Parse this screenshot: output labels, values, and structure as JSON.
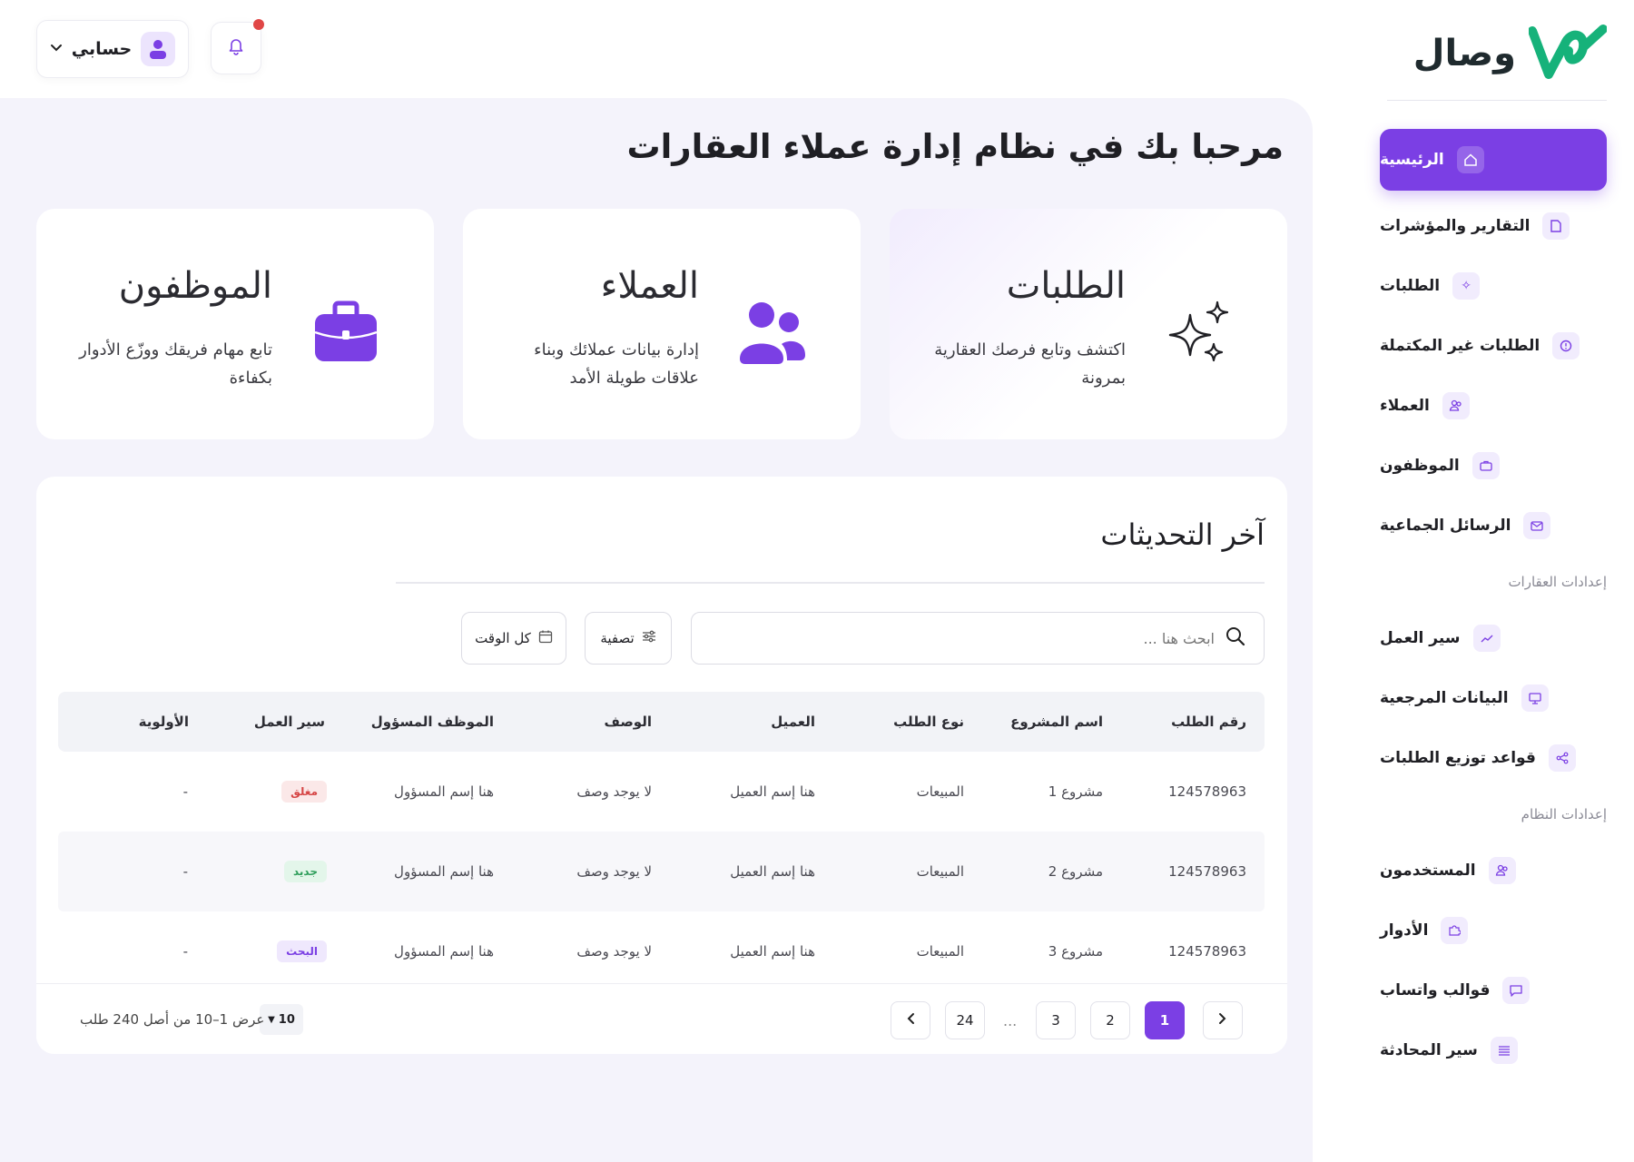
{
  "brand": {
    "name": "وصال"
  },
  "topbar": {
    "account_label": "حسابي"
  },
  "sidebar": {
    "items": [
      {
        "label": "الرئيسية",
        "active": true
      },
      {
        "label": "التقارير والمؤشرات"
      },
      {
        "label": "الطلبات"
      },
      {
        "label": "الطلبات غير المكتملة"
      },
      {
        "label": "العملاء"
      },
      {
        "label": "الموظفون"
      },
      {
        "label": "الرسائل الجماعية"
      }
    ],
    "section_realestate": "إعدادات العقارات",
    "realestate_items": [
      {
        "label": "سير العمل"
      },
      {
        "label": "البيانات المرجعية"
      },
      {
        "label": "قواعد توزيع الطلبات"
      }
    ],
    "section_system": "إعدادات النظام",
    "system_items": [
      {
        "label": "المستخدمون"
      },
      {
        "label": "الأدوار"
      },
      {
        "label": "قوالب واتساب"
      },
      {
        "label": "سير المحادثة"
      }
    ]
  },
  "main": {
    "title": "مرحبا بك في نظام إدارة عملاء العقارات",
    "cards": [
      {
        "title": "الطلبات",
        "desc": "اكتشف وتابع فرصك العقارية بمرونة"
      },
      {
        "title": "العملاء",
        "desc": "إدارة بيانات عملائك وبناء علاقات طويلة الأمد"
      },
      {
        "title": "الموظفون",
        "desc": "تابع مهام فريقك ووزّع الأدوار بكفاءة"
      }
    ]
  },
  "updates": {
    "title": "آخر التحديثات",
    "search_placeholder": "ابحث هنا ...",
    "filter_label": "تصفية",
    "time_label": "كل الوقت",
    "columns": [
      "رقم الطلب",
      "اسم المشروع",
      "نوع الطلب",
      "العميل",
      "الوصف",
      "الموظف المسؤول",
      "سير العمل",
      "الأولوية"
    ],
    "rows": [
      {
        "id": "124578963",
        "project": "مشروع 1",
        "type": "المبيعات",
        "client": "هنا إسم العميل",
        "desc": "لا يوجد وصف",
        "owner": "هنا إسم المسؤول",
        "status": "مغلق",
        "priority": "-"
      },
      {
        "id": "124578963",
        "project": "مشروع 2",
        "type": "المبيعات",
        "client": "هنا إسم العميل",
        "desc": "لا يوجد وصف",
        "owner": "هنا إسم المسؤول",
        "status": "جديد",
        "priority": "-"
      },
      {
        "id": "124578963",
        "project": "مشروع 3",
        "type": "المبيعات",
        "client": "هنا إسم العميل",
        "desc": "لا يوجد وصف",
        "owner": "هنا إسم المسؤول",
        "status": "البحث",
        "priority": "-"
      }
    ],
    "status_colors": {
      "closed": "#d64545",
      "new": "#2f9e5b",
      "search": "#7b3fe4"
    },
    "pagination": {
      "pages": [
        "1",
        "2",
        "3",
        "24"
      ],
      "dots": "...",
      "current_page": 1,
      "per_page": "10",
      "range_text": "عرض 1–10 من أصل 240 طلب"
    }
  },
  "colors": {
    "accent": "#7b3fe4",
    "logo_green": "#16b27a"
  }
}
